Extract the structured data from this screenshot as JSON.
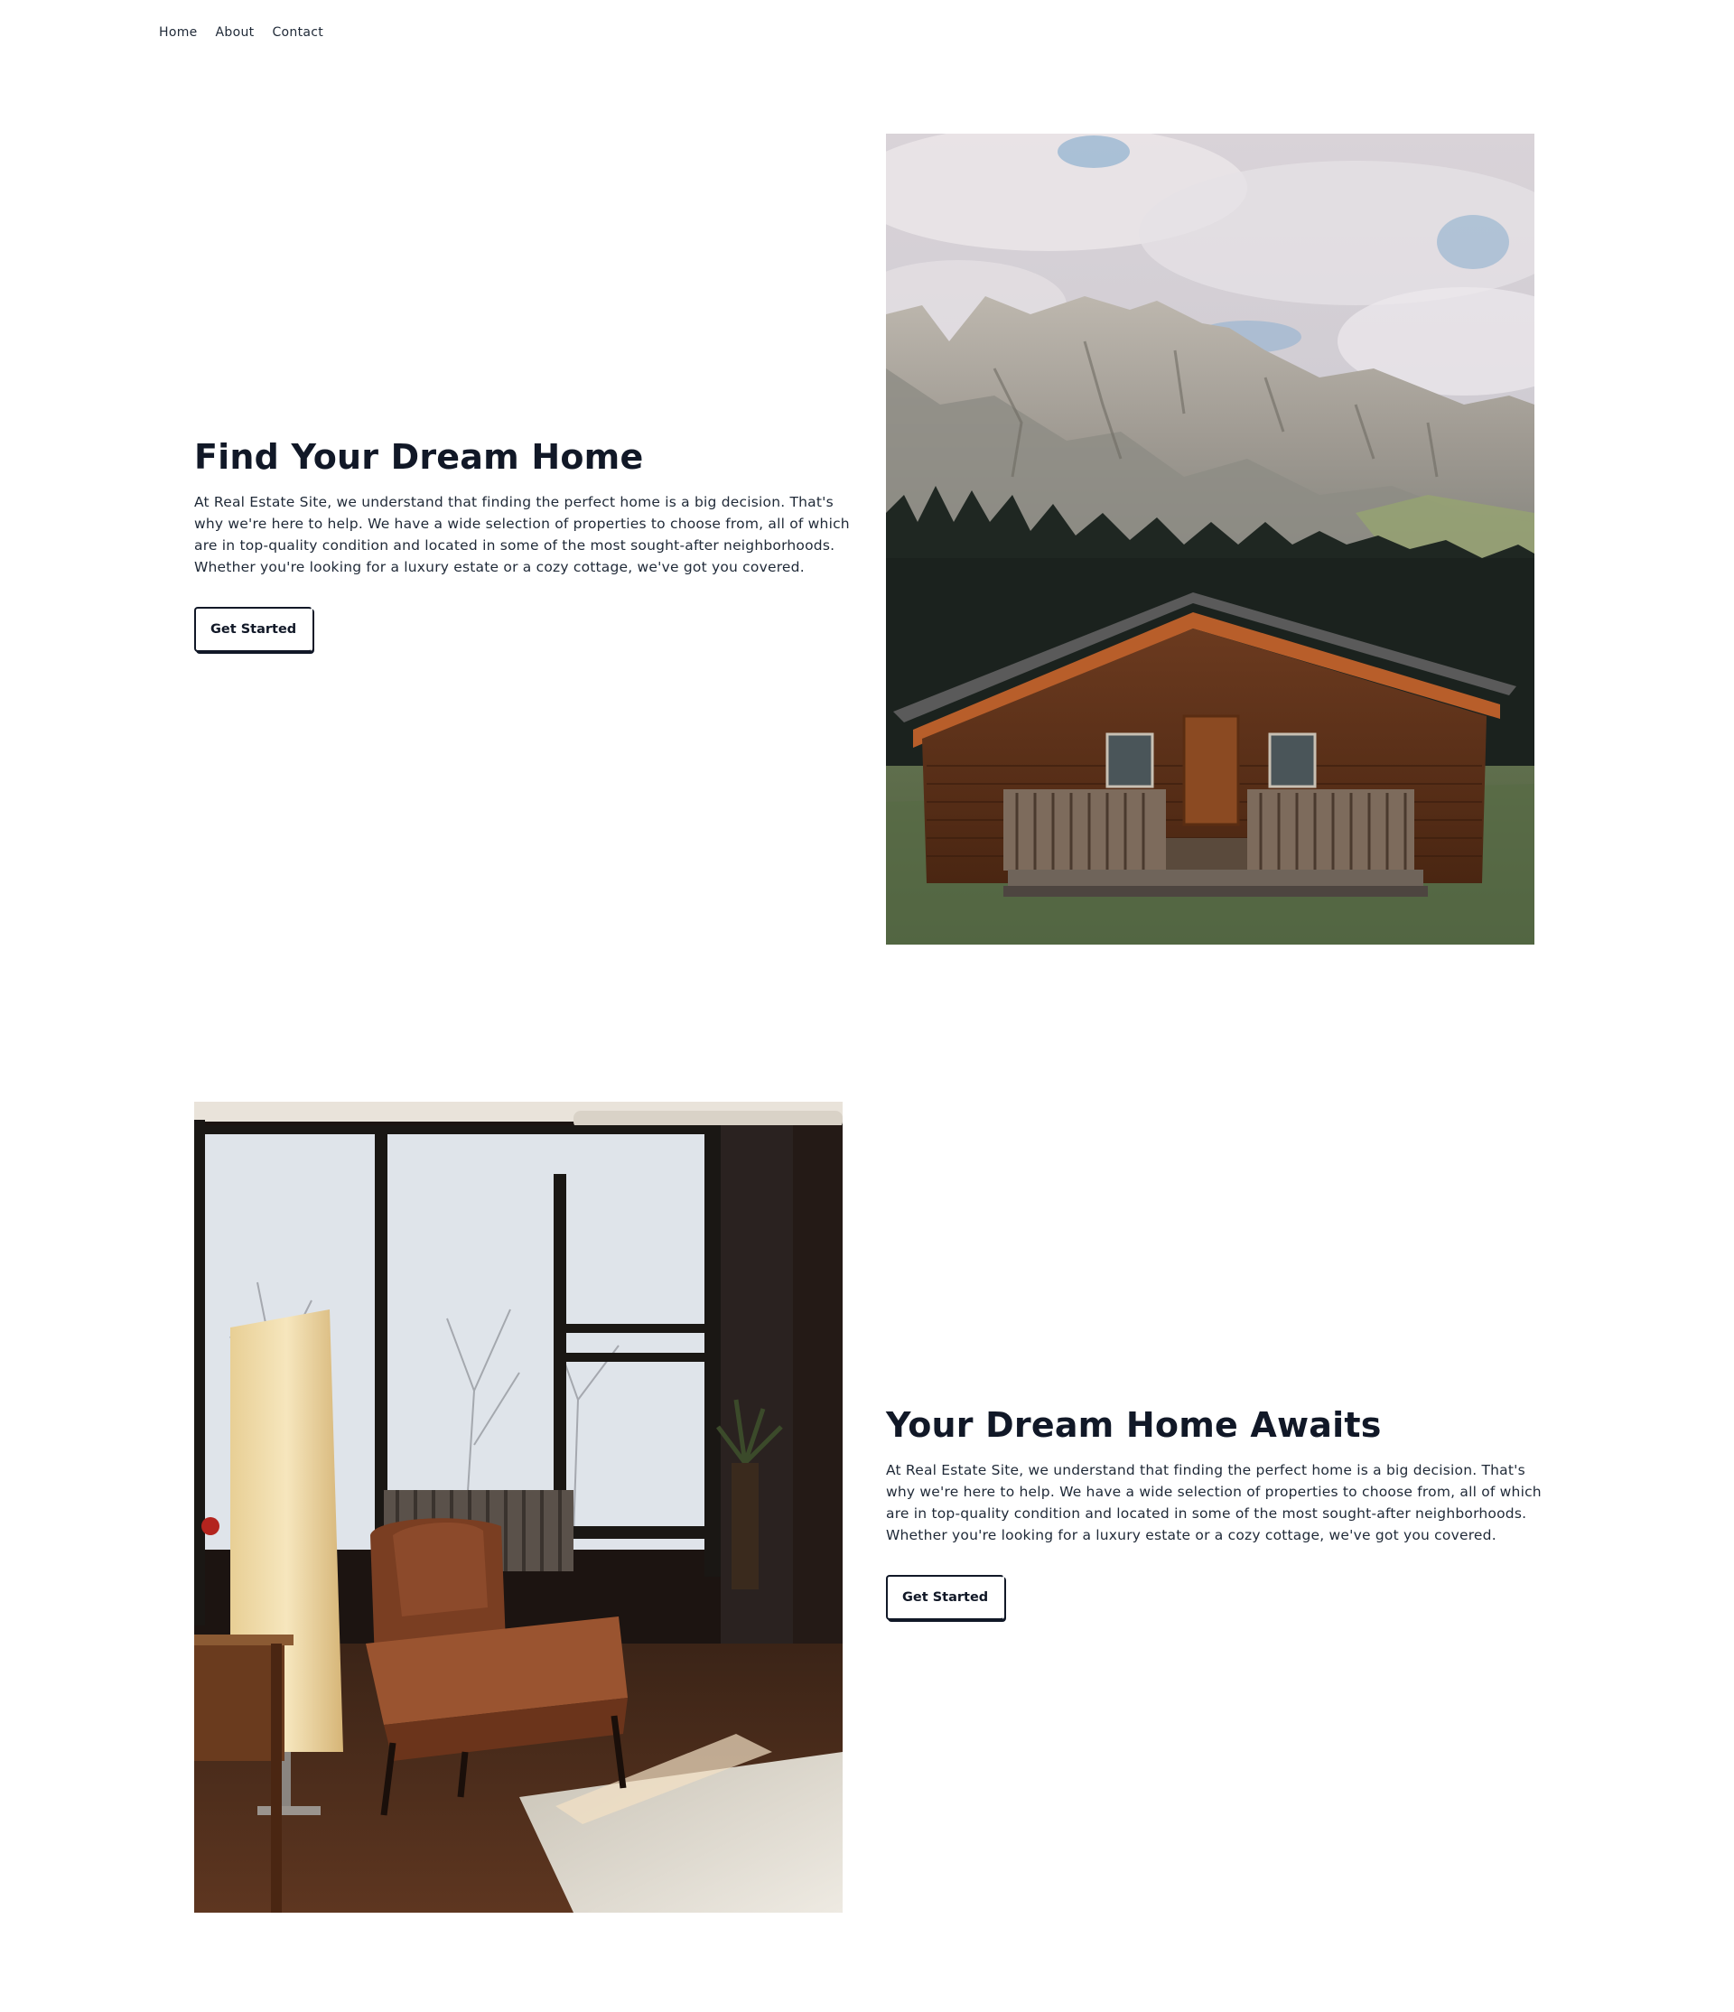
{
  "nav": {
    "items": [
      "Home",
      "About",
      "Contact"
    ]
  },
  "sections": [
    {
      "heading": "Find Your Dream Home",
      "body": "At Real Estate Site, we understand that finding the perfect home is a big decision. That's why we're here to help. We have a wide selection of properties to choose from, all of which are in top-quality condition and located in some of the most sought-after neighborhoods. Whether you're looking for a luxury estate or a cozy cottage, we've got you covered.",
      "button": "Get Started",
      "image": "log-cabin-mountain-photo"
    },
    {
      "heading": "Your Dream Home Awaits",
      "body": "At Real Estate Site, we understand that finding the perfect home is a big decision. That's why we're here to help. We have a wide selection of properties to choose from, all of which are in top-quality condition and located in some of the most sought-after neighborhoods. Whether you're looking for a luxury estate or a cozy cottage, we've got you covered.",
      "button": "Get Started",
      "image": "living-room-armchair-photo"
    }
  ]
}
